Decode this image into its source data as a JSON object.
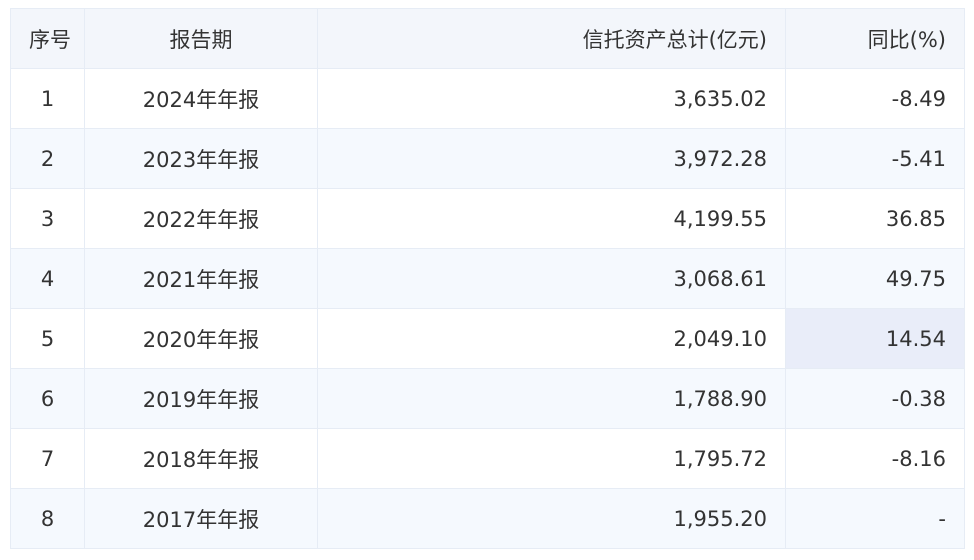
{
  "table": {
    "headers": {
      "index": "序号",
      "period": "报告期",
      "assets": "信托资产总计(亿元)",
      "yoy": "同比(%)"
    },
    "rows": [
      {
        "index": "1",
        "period": "2024年年报",
        "assets": "3,635.02",
        "yoy": "-8.49"
      },
      {
        "index": "2",
        "period": "2023年年报",
        "assets": "3,972.28",
        "yoy": "-5.41"
      },
      {
        "index": "3",
        "period": "2022年年报",
        "assets": "4,199.55",
        "yoy": "36.85"
      },
      {
        "index": "4",
        "period": "2021年年报",
        "assets": "3,068.61",
        "yoy": "49.75"
      },
      {
        "index": "5",
        "period": "2020年年报",
        "assets": "2,049.10",
        "yoy": "14.54"
      },
      {
        "index": "6",
        "period": "2019年年报",
        "assets": "1,788.90",
        "yoy": "-0.38"
      },
      {
        "index": "7",
        "period": "2018年年报",
        "assets": "1,795.72",
        "yoy": "-8.16"
      },
      {
        "index": "8",
        "period": "2017年年报",
        "assets": "1,955.20",
        "yoy": "-"
      }
    ]
  },
  "colors": {
    "header_bg": "#f3f6fb",
    "stripe_bg": "#f5f9fe",
    "highlight_bg": "#e9edf9",
    "border": "#e6ecf5"
  }
}
